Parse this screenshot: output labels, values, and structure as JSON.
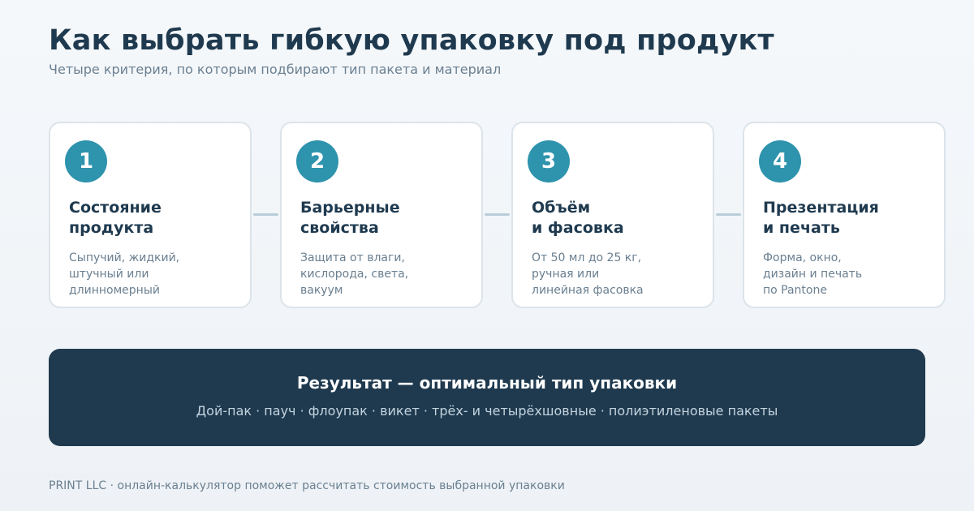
{
  "header": {
    "title": "Как выбрать гибкую упаковку под продукт",
    "subtitle": "Четыре критерия, по которым подбирают тип пакета и материал"
  },
  "steps": [
    {
      "number": "1",
      "title": "Состояние\nпродукта",
      "description": "Сыпучий, жидкий,\nштучный или\nдлинномерный"
    },
    {
      "number": "2",
      "title": "Барьерные\nсвойства",
      "description": "Защита от влаги,\nкислорода, света,\nвакуум"
    },
    {
      "number": "3",
      "title": "Объём\nи фасовка",
      "description": "От 50 мл до 25 кг,\nручная или\nлинейная фасовка"
    },
    {
      "number": "4",
      "title": "Презентация\nи печать",
      "description": "Форма, окно,\nдизайн и печать\nпо Pantone"
    }
  ],
  "result": {
    "title": "Результат — оптимальный тип упаковки",
    "items": "Дой-пак · пауч · флоупак · викет · трёх- и четырёхшовные · полиэтиленовые пакеты"
  },
  "footer": {
    "text": "PRINT LLC · онлайн-калькулятор поможет рассчитать стоимость выбранной упаковки"
  },
  "colors": {
    "accent": "#2e93ad",
    "dark": "#1f3a4f",
    "muted": "#6a7f90",
    "card_border": "#dce4ea",
    "connector": "#b9cdd8"
  }
}
